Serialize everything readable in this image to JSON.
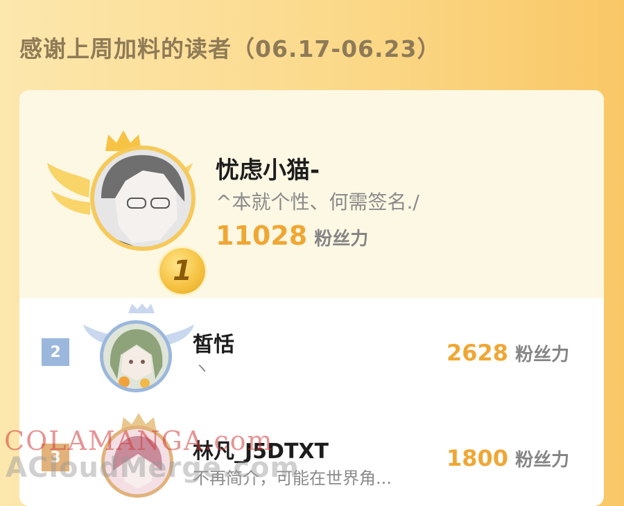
{
  "header": {
    "title": "感谢上周加料的读者（06.17-06.23）"
  },
  "colors": {
    "accent": "#efa734",
    "background": "#fbd98a",
    "rank2": "#9bb7dc"
  },
  "leaders": [
    {
      "rank": "1",
      "name": "忧虑小猫-",
      "bio": "^本就个性、何需签名./",
      "fans": "11028",
      "fans_unit": "粉丝力",
      "avatar_icon": "avatar-gray-hair-glasses"
    },
    {
      "rank": "2",
      "name": "皙恬",
      "bio": "ヽ",
      "fans": "2628",
      "fans_unit": "粉丝力",
      "avatar_icon": "avatar-green-hair-girl"
    },
    {
      "rank": "3",
      "name": "林凡_J5DTXT",
      "bio": "不再简介，可能在世界角...",
      "fans": "1800",
      "fans_unit": "粉丝力",
      "avatar_icon": "avatar-pink-girl"
    }
  ],
  "watermark": {
    "line1": "COLAMANGA.com",
    "line2": "ACloudMerge.com"
  }
}
